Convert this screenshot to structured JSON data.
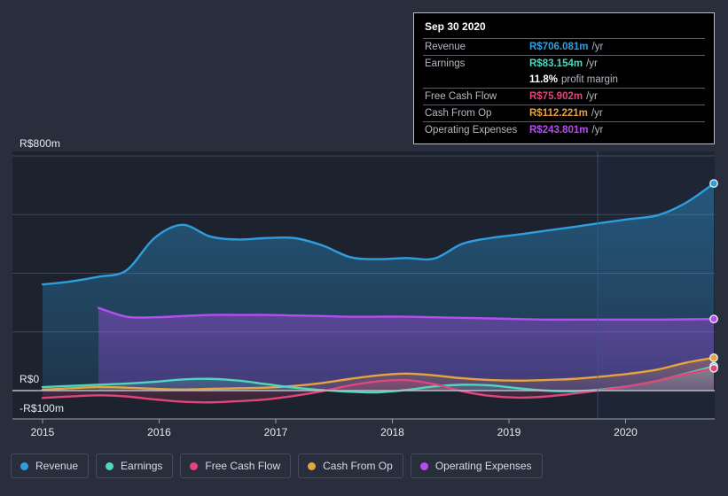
{
  "background": "#282e3c",
  "plot_background": "#1c222e",
  "axis": {
    "y_labels": [
      {
        "text": "R$800m",
        "value": 800
      },
      {
        "text": "R$0",
        "value": 0
      },
      {
        "text": "-R$100m",
        "value": -100
      }
    ],
    "x_labels": [
      "2015",
      "2016",
      "2017",
      "2018",
      "2019",
      "2020"
    ]
  },
  "tooltip": {
    "title": "Sep 30 2020",
    "rows": [
      {
        "key": "Revenue",
        "value": "R$706.081m",
        "unit": "/yr",
        "color": "#2f9ee0"
      },
      {
        "key": "Earnings",
        "value": "R$83.154m",
        "unit": "/yr",
        "color": "#4fd6bb"
      },
      {
        "key": "",
        "value": "11.8%",
        "unit": "profit margin",
        "color": "#ffffff",
        "sub": true
      },
      {
        "key": "Free Cash Flow",
        "value": "R$75.902m",
        "unit": "/yr",
        "color": "#e0457b"
      },
      {
        "key": "Cash From Op",
        "value": "R$112.221m",
        "unit": "/yr",
        "color": "#e8a33d"
      },
      {
        "key": "Operating Expenses",
        "value": "R$243.801m",
        "unit": "/yr",
        "color": "#b44ef0"
      }
    ]
  },
  "legend": {
    "items": [
      {
        "label": "Revenue",
        "color": "#2f9ee0"
      },
      {
        "label": "Earnings",
        "color": "#4fd6bb"
      },
      {
        "label": "Free Cash Flow",
        "color": "#e0457b"
      },
      {
        "label": "Cash From Op",
        "color": "#e8a33d"
      },
      {
        "label": "Operating Expenses",
        "color": "#b44ef0"
      }
    ]
  },
  "chart_data": {
    "type": "area",
    "title": "",
    "xlabel": "",
    "ylabel": "",
    "ylim": [
      -100,
      800
    ],
    "grid": true,
    "legend_position": "bottom",
    "currency": "R$",
    "units": "millions",
    "x": [
      "2015.00",
      "2015.25",
      "2015.50",
      "2015.75",
      "2016.00",
      "2016.25",
      "2016.50",
      "2016.75",
      "2017.00",
      "2017.25",
      "2017.50",
      "2017.75",
      "2018.00",
      "2018.25",
      "2018.50",
      "2018.75",
      "2019.00",
      "2019.25",
      "2019.50",
      "2019.75",
      "2020.00",
      "2020.25",
      "2020.50",
      "2020.75"
    ],
    "series": [
      {
        "name": "Revenue",
        "color": "#2f9ee0",
        "values": [
          362,
          372,
          388,
          410,
          520,
          565,
          525,
          515,
          520,
          520,
          495,
          455,
          448,
          452,
          450,
          500,
          520,
          532,
          545,
          558,
          572,
          585,
          598,
          640,
          706
        ]
      },
      {
        "name": "Earnings",
        "color": "#4fd6bb",
        "values": [
          12,
          16,
          20,
          24,
          30,
          38,
          40,
          34,
          22,
          10,
          2,
          -4,
          -6,
          2,
          14,
          20,
          18,
          8,
          0,
          -2,
          4,
          16,
          34,
          58,
          83
        ]
      },
      {
        "name": "Free Cash Flow",
        "color": "#e0457b",
        "values": [
          -25,
          -20,
          -16,
          -20,
          -30,
          -38,
          -40,
          -36,
          -30,
          -18,
          -2,
          18,
          32,
          36,
          22,
          -2,
          -18,
          -24,
          -20,
          -10,
          2,
          16,
          34,
          56,
          76
        ]
      },
      {
        "name": "Cash From Op",
        "color": "#e8a33d",
        "values": [
          3,
          8,
          12,
          10,
          6,
          4,
          6,
          8,
          10,
          16,
          26,
          40,
          52,
          58,
          52,
          42,
          36,
          34,
          36,
          40,
          48,
          58,
          72,
          95,
          112
        ]
      },
      {
        "name": "Operating Expenses",
        "color": "#b44ef0",
        "values": [
          null,
          null,
          282,
          252,
          250,
          254,
          258,
          258,
          258,
          256,
          254,
          252,
          252,
          252,
          250,
          248,
          246,
          244,
          242,
          242,
          242,
          242,
          242,
          243,
          244
        ]
      }
    ],
    "highlight_marker": {
      "date": "Sep 30 2020",
      "revenue": 706.081,
      "earnings": 83.154,
      "profit_margin_pct": 11.8,
      "free_cash_flow": 75.902,
      "cash_from_op": 112.221,
      "operating_expenses": 243.801
    }
  }
}
